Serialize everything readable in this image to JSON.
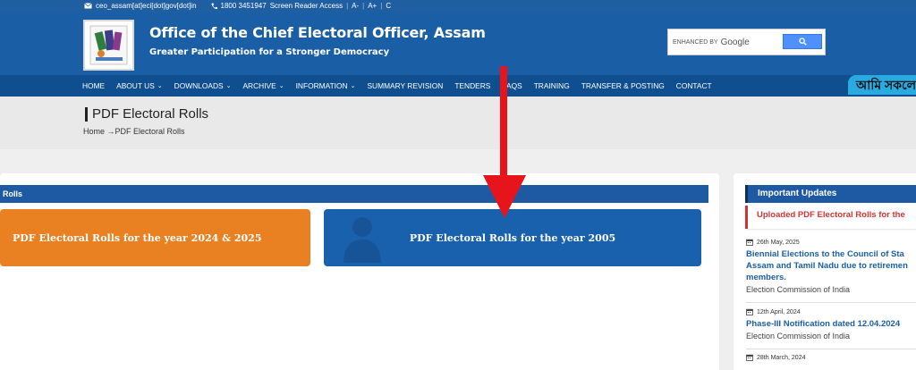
{
  "topbar": {
    "email": "ceo_assam[at]eci[dot]gov[dot]in",
    "phone": "1800 3451947",
    "screen_reader": "Screen Reader Access",
    "font_decrease": "A-",
    "font_increase": "A+",
    "contrast": "C"
  },
  "header": {
    "title": "Office of the Chief Electoral Officer, Assam",
    "subtitle": "Greater Participation for a Stronger Democracy",
    "search": {
      "label": "ENHANCED BY",
      "brand": "Google",
      "button_icon": "search-icon"
    }
  },
  "nav": {
    "items": [
      {
        "label": "HOME",
        "dropdown": false
      },
      {
        "label": "ABOUT US",
        "dropdown": true
      },
      {
        "label": "DOWNLOADS",
        "dropdown": true
      },
      {
        "label": "ARCHIVE",
        "dropdown": true
      },
      {
        "label": "INFORMATION",
        "dropdown": true
      },
      {
        "label": "SUMMARY REVISION",
        "dropdown": false
      },
      {
        "label": "TENDERS",
        "dropdown": false
      },
      {
        "label": "FAQS",
        "dropdown": false
      },
      {
        "label": "TRAINING",
        "dropdown": false
      },
      {
        "label": "TRANSFER & POSTING",
        "dropdown": false
      },
      {
        "label": "CONTACT",
        "dropdown": false
      }
    ],
    "language_tab": "আমি সকলে"
  },
  "page": {
    "title": "PDF Electoral Rolls",
    "breadcrumb_home": "Home",
    "breadcrumb_sep": "→",
    "breadcrumb_current": "PDF Electoral Rolls"
  },
  "main": {
    "section_label": "Rolls",
    "tiles": [
      {
        "label": "PDF Electoral Rolls for the year 2024 & 2025",
        "color": "#e98022"
      },
      {
        "label": "PDF Electoral Rolls for the year 2005",
        "color": "#1a61ad"
      }
    ]
  },
  "sidebar": {
    "heading": "Important Updates",
    "highlight": "Uploaded PDF Electoral Rolls for the",
    "news": [
      {
        "date": "26th May, 2025",
        "headline_lines": [
          "Biennial Elections to the Council of Sta",
          "Assam and Tamil Nadu due to retiremen",
          "members."
        ],
        "source": "Election Commission of India"
      },
      {
        "date": "12th April, 2024",
        "headline_lines": [
          "Phase-III Notification dated 12.04.2024"
        ],
        "source": "Election Commission of India"
      },
      {
        "date": "28th March, 2024",
        "headline_lines": [],
        "source": ""
      }
    ]
  },
  "colors": {
    "header_blue": "#1a5fa6",
    "nav_blue": "#0f4f8f",
    "tile_orange": "#e98022",
    "tile_blue": "#1a61ad",
    "alert_red": "#d93333",
    "arrow_red": "#e8141c"
  }
}
